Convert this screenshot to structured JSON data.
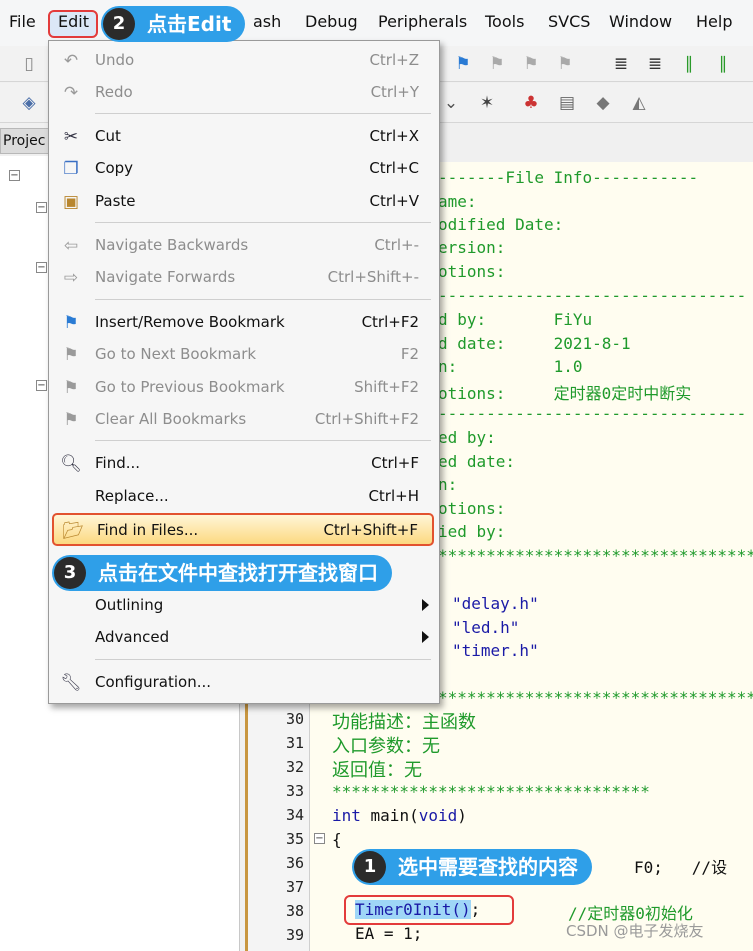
{
  "menubar": {
    "items": [
      "File",
      "Edit",
      "ash",
      "Debug",
      "Peripherals",
      "Tools",
      "SVCS",
      "Window",
      "Help"
    ]
  },
  "panel": {
    "tab_label": "Projec"
  },
  "editor": {
    "line_numbers": [
      "30",
      "31",
      "32",
      "33",
      "34",
      "35",
      "36",
      "37",
      "38",
      "39"
    ],
    "lines": {
      "l1": "-------File Info-----------",
      "l2": "ame:",
      "l3": "odified Date:",
      "l4": "ersion:",
      "l5": "otions:",
      "l6": "--------------------------------",
      "l7": "d by:       FiYu",
      "l8": "d date:     2021-8-1",
      "l9": "n:          1.0",
      "l10": "otions:     定时器0定时中断实",
      "l11": "--------------------------------",
      "l12": "ed by:",
      "l13": "ed date:",
      "l14": "n:",
      "l15": "otions:",
      "l16": "ied by:",
      "l17": "*********************************",
      "l18": "\"delay.h\"",
      "l19": "\"led.h\"",
      "l20": "\"timer.h\"",
      "l21": "*********************************",
      "l30": "功能描述：主函数",
      "l31": "入口参数：无",
      "l32": "返回值：无",
      "l33": "*********************************",
      "l34_kw": "int",
      "l34_rest": " main(",
      "l34_kw2": "void",
      "l34_end": ")",
      "l35": "{",
      "l36": "F0;   //设",
      "l38_sel": "Timer0Init()",
      "l38_end": ";",
      "l38_cm": "//定时器0初始化",
      "l39": "EA = 1;"
    }
  },
  "dropdown": {
    "items": [
      {
        "label": "Undo",
        "shortcut": "Ctrl+Z",
        "icon": "undo-icon"
      },
      {
        "label": "Redo",
        "shortcut": "Ctrl+Y",
        "icon": "redo-icon"
      },
      {
        "label": "Cut",
        "shortcut": "Ctrl+X",
        "icon": "scissors-icon"
      },
      {
        "label": "Copy",
        "shortcut": "Ctrl+C",
        "icon": "copy-icon"
      },
      {
        "label": "Paste",
        "shortcut": "Ctrl+V",
        "icon": "paste-icon"
      },
      {
        "label": "Navigate Backwards",
        "shortcut": "Ctrl+-",
        "icon": "arrow-left-icon"
      },
      {
        "label": "Navigate Forwards",
        "shortcut": "Ctrl+Shift+-",
        "icon": "arrow-right-icon"
      },
      {
        "label": "Insert/Remove Bookmark",
        "shortcut": "Ctrl+F2",
        "icon": "bookmark-icon"
      },
      {
        "label": "Go to Next Bookmark",
        "shortcut": "F2",
        "icon": "next-bookmark-icon"
      },
      {
        "label": "Go to Previous Bookmark",
        "shortcut": "Shift+F2",
        "icon": "prev-bookmark-icon"
      },
      {
        "label": "Clear All Bookmarks",
        "shortcut": "Ctrl+Shift+F2",
        "icon": "clear-bookmarks-icon"
      },
      {
        "label": "Find...",
        "shortcut": "Ctrl+F",
        "icon": "find-icon"
      },
      {
        "label": "Replace...",
        "shortcut": "Ctrl+H",
        "icon": ""
      },
      {
        "label": "Find in Files...",
        "shortcut": "Ctrl+Shift+F",
        "icon": "find-in-files-icon"
      },
      {
        "label": "Outlining",
        "shortcut": "",
        "icon": ""
      },
      {
        "label": "Advanced",
        "shortcut": "",
        "icon": ""
      },
      {
        "label": "Configuration...",
        "shortcut": "",
        "icon": "wrench-icon"
      }
    ]
  },
  "callouts": {
    "step1_num": "1",
    "step1_text": "选中需要查找的内容",
    "step2_num": "2",
    "step2_text": "点击Edit",
    "step3_num": "3",
    "step3_text": "点击在文件中查找打开查找窗口"
  },
  "watermark": "CSDN @电子发烧友",
  "colors": {
    "callout": "#2f9fe8",
    "highlight_border": "#e33b3b",
    "comment": "#1f9a2b",
    "keyword": "#1a1aa6"
  }
}
